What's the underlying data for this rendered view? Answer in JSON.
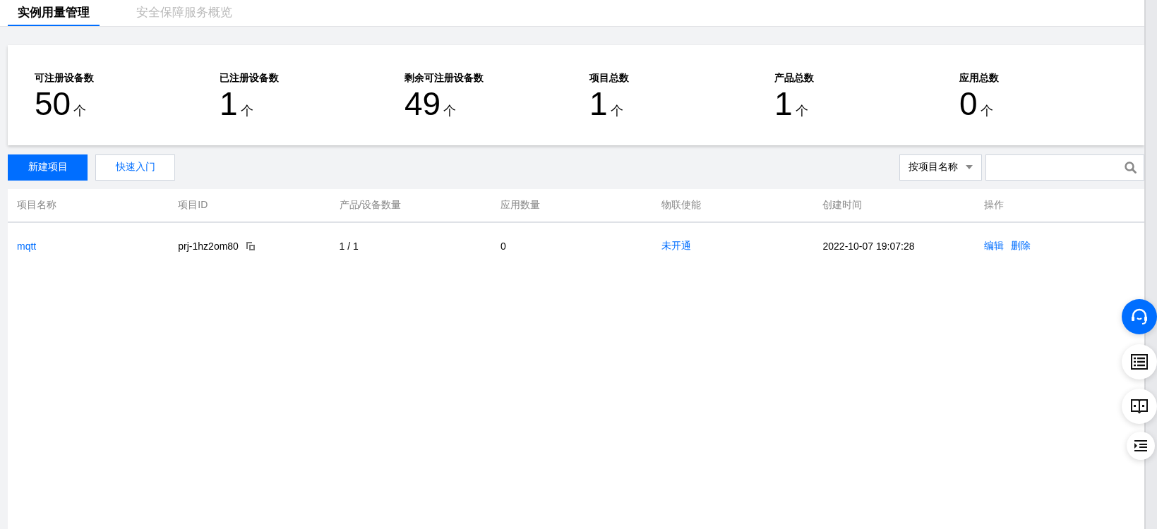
{
  "tabs": [
    {
      "label": "实例用量管理",
      "selected": true
    },
    {
      "label": "安全保障服务概览",
      "selected": false
    }
  ],
  "stats": [
    {
      "label": "可注册设备数",
      "value": "50",
      "unit": "个"
    },
    {
      "label": "已注册设备数",
      "value": "1",
      "unit": "个"
    },
    {
      "label": "剩余可注册设备数",
      "value": "49",
      "unit": "个"
    },
    {
      "label": "项目总数",
      "value": "1",
      "unit": "个"
    },
    {
      "label": "产品总数",
      "value": "1",
      "unit": "个"
    },
    {
      "label": "应用总数",
      "value": "0",
      "unit": "个"
    }
  ],
  "toolbar": {
    "primary_button": "新建项目",
    "secondary_button": "快速入门",
    "filter_select": "按项目名称"
  },
  "table": {
    "columns": [
      "项目名称",
      "项目ID",
      "产品/设备数量",
      "应用数量",
      "物联使能",
      "创建时间",
      "操作"
    ],
    "rows": [
      {
        "cells": [
          {
            "kind": "link",
            "text": "mqtt"
          },
          {
            "kind": "copy",
            "text": "prj-1hz2om80"
          },
          {
            "kind": "text",
            "text": "1 / 1"
          },
          {
            "kind": "text",
            "text": "0"
          },
          {
            "kind": "link",
            "text": "未开通"
          },
          {
            "kind": "text",
            "text": "2022-10-07 19:07:28"
          },
          {
            "kind": "actions",
            "links": [
              "编辑",
              "删除"
            ]
          }
        ]
      }
    ]
  }
}
